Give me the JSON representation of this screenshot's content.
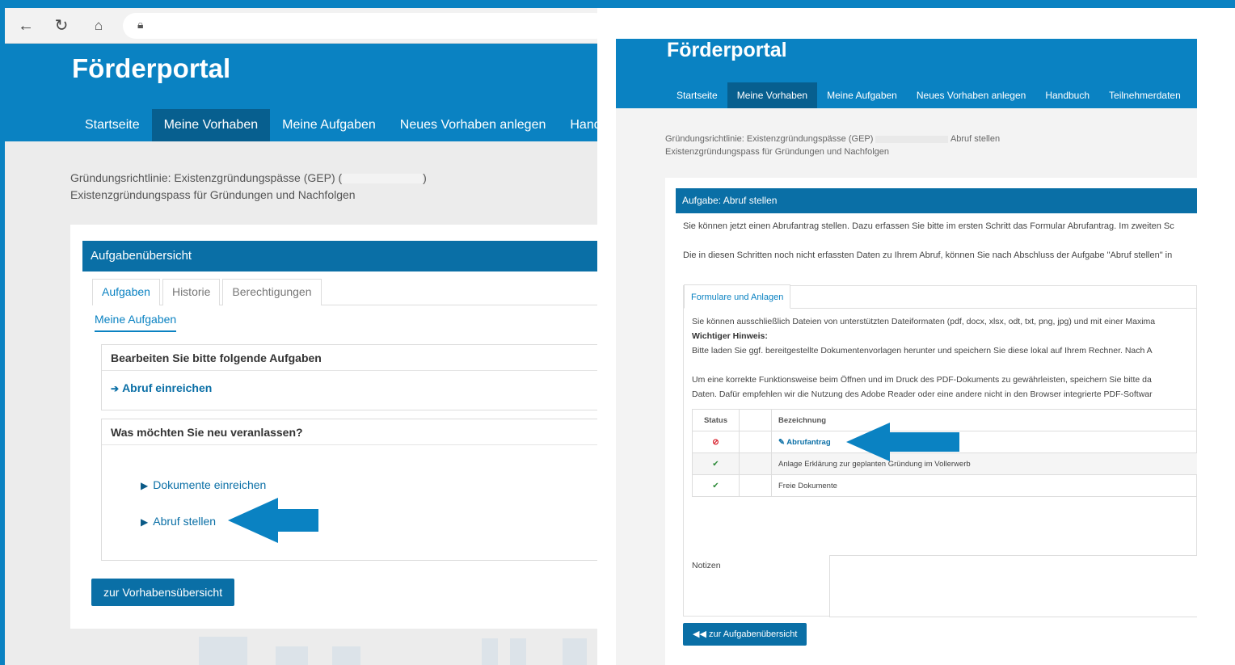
{
  "left": {
    "portal_title": "Förderportal",
    "nav": [
      "Startseite",
      "Meine Vorhaben",
      "Meine Aufgaben",
      "Neues Vorhaben anlegen",
      "Handbu"
    ],
    "breadcrumb_line1_prefix": "Gründungsrichtlinie: Existenzgründungspässe (GEP) (",
    "breadcrumb_line1_suffix": ")",
    "breadcrumb_line2": "Existenzgründungspass für Gründungen und Nachfolgen",
    "card_title": "Aufgabenübersicht",
    "tabs": [
      "Aufgaben",
      "Historie",
      "Berechtigungen"
    ],
    "subtab": "Meine Aufgaben",
    "tasks_heading": "Bearbeiten Sie bitte folgende Aufgaben",
    "task_link": "Abruf einreichen",
    "new_heading": "Was möchten Sie neu veranlassen?",
    "options": [
      "Dokumente einreichen",
      "Abruf stellen"
    ],
    "button": "zur Vorhabensübersicht"
  },
  "right": {
    "portal_title": "Förderportal",
    "nav": [
      "Startseite",
      "Meine Vorhaben",
      "Meine Aufgaben",
      "Neues Vorhaben anlegen",
      "Handbuch",
      "Teilnehmerdaten"
    ],
    "breadcrumb_line1_prefix": "Gründungsrichtlinie: Existenzgründungspässe (GEP)",
    "breadcrumb_line1_suffix": "Abruf stellen",
    "breadcrumb_line2": "Existenzgründungspass für Gründungen und Nachfolgen",
    "card_title": "Aufgabe: Abruf stellen",
    "intro1": "Sie können jetzt einen Abrufantrag stellen. Dazu erfassen Sie bitte im ersten Schritt das Formular Abrufantrag. Im zweiten Sc",
    "intro2": "Die in diesen Schritten noch nicht erfassten Daten zu Ihrem Abruf, können Sie nach Abschluss der Aufgabe \"Abruf stellen\" in",
    "tab": "Formulare und Anlagen",
    "info1": "Sie können ausschließlich Dateien von unterstützten Dateiformaten (pdf, docx, xlsx, odt, txt, png, jpg) und mit einer Maxima",
    "hint_label": "Wichtiger Hinweis:",
    "info2": "Bitte laden Sie ggf. bereitgestellte Dokumentenvorlagen herunter und speichern Sie diese lokal auf Ihrem Rechner. Nach A",
    "info3": "Um eine korrekte Funktionsweise beim Öffnen und im Druck des PDF-Dokuments zu gewährleisten, speichern Sie bitte da",
    "info4": "Daten. Dafür empfehlen wir die Nutzung des Adobe Reader oder eine andere nicht in den Browser integrierte PDF-Softwar",
    "table_headers": [
      "Status",
      "Bezeichnung"
    ],
    "rows": [
      {
        "status": "error",
        "glyph": "⊘",
        "label": "Abrufantrag",
        "link": true
      },
      {
        "status": "ok",
        "glyph": "✔",
        "label": "Anlage Erklärung zur geplanten Gründung im Vollerwerb",
        "link": false
      },
      {
        "status": "ok",
        "glyph": "✔",
        "label": "Freie Dokumente",
        "link": false
      }
    ],
    "notes_label": "Notizen",
    "button": "zur Aufgabenübersicht"
  },
  "colors": {
    "brand": "#0a82c2",
    "brand_dark": "#0a6fa6",
    "arrow": "#0a82c2"
  }
}
